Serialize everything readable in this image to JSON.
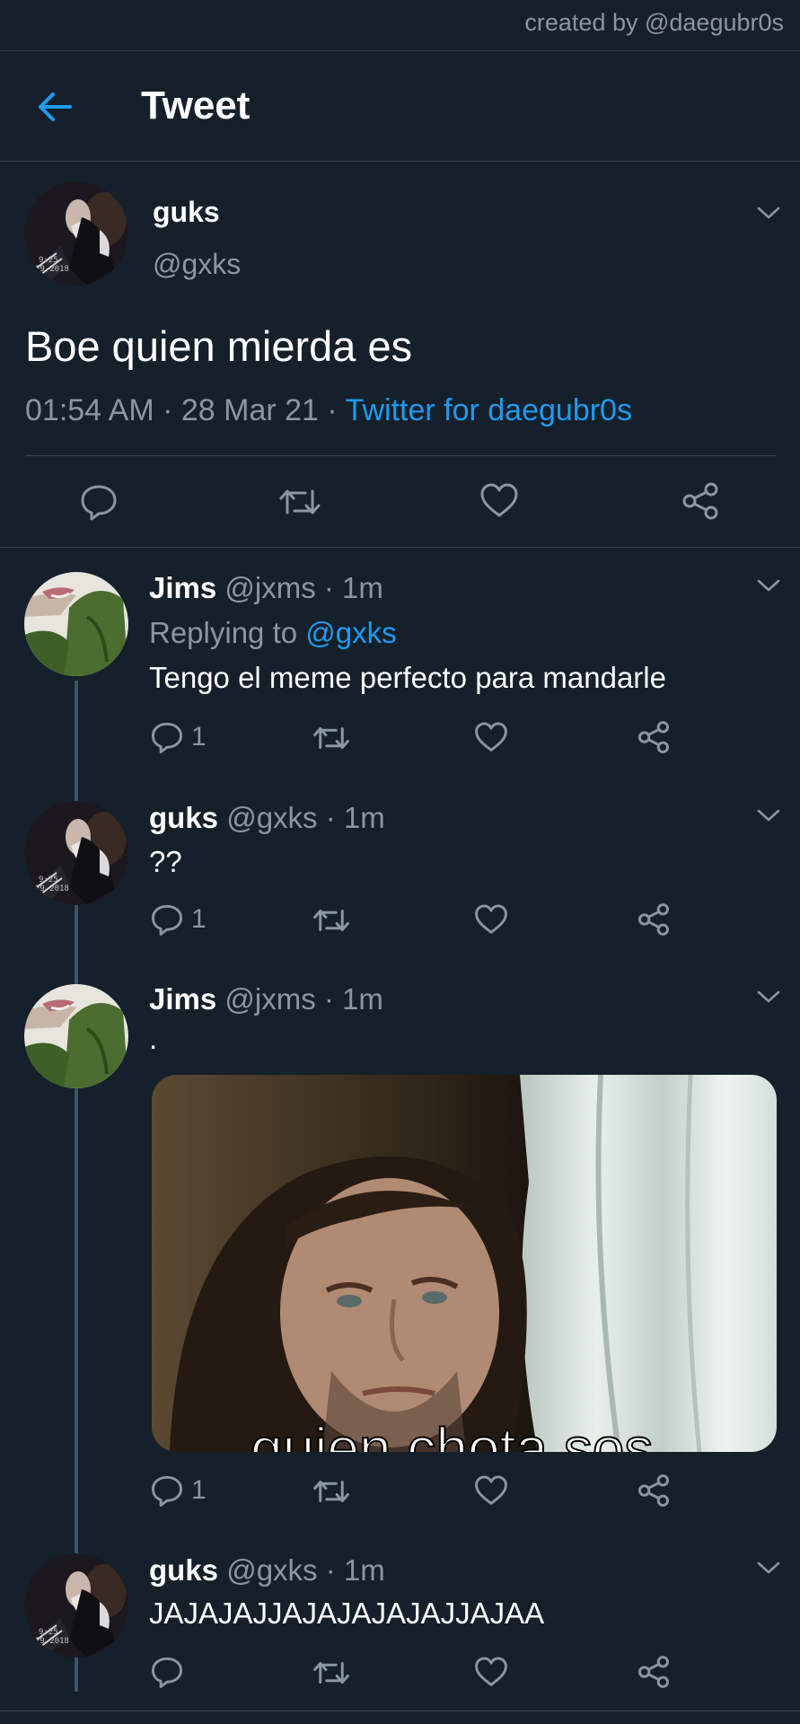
{
  "watermark": "created by @daegubr0s",
  "header": {
    "title": "Tweet",
    "back_icon": "arrow-left-icon"
  },
  "main_tweet": {
    "name": "guks",
    "handle": "@gxks",
    "text": "Boe quien mierda es",
    "time": "01:54 AM",
    "sep1": " · ",
    "date": "28 Mar 21",
    "sep2": " · ",
    "source": "Twitter for daegubr0s"
  },
  "avatar_stamp": {
    "line1": "9:25",
    "line2": "29 2018"
  },
  "replies": [
    {
      "name": "Jims",
      "handle": "@jxms",
      "dot": " · ",
      "age": "1m",
      "replying_label": "Replying to ",
      "replying_to": "@gxks",
      "text": "Tengo el meme perfecto para mandarle",
      "reply_count": "1"
    },
    {
      "name": "guks",
      "handle": "@gxks",
      "dot": " · ",
      "age": "1m",
      "text": "??",
      "reply_count": "1"
    },
    {
      "name": "Jims",
      "handle": "@jxms",
      "dot": " · ",
      "age": "1m",
      "text": ".",
      "reply_count": "1",
      "media_caption": "quien chota sos"
    },
    {
      "name": "guks",
      "handle": "@gxks",
      "dot": " · ",
      "age": "1m",
      "text": "JAJAJAJJAJAJAJAJAJJAJAA",
      "reply_count": ""
    }
  ],
  "colors": {
    "background": "#15202b",
    "accent": "#1d9bf0",
    "secondary": "#8a96a3",
    "divider": "#38444d"
  }
}
